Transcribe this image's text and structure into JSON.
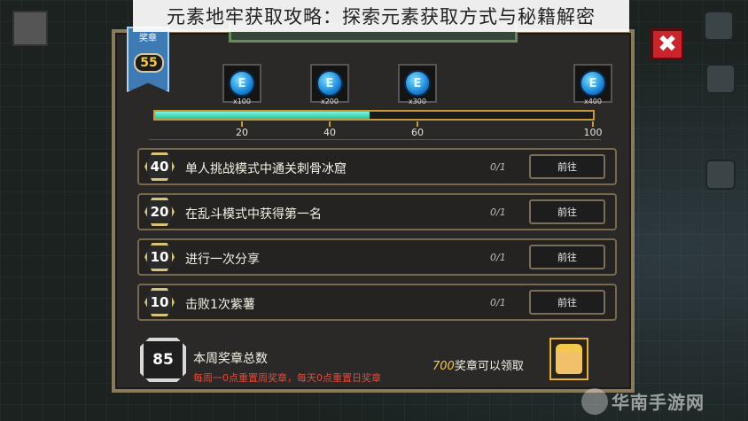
{
  "overlay_title": "元素地牢获取攻略：探索元素获取方式与秘籍解密",
  "badge": {
    "label": "奖章",
    "level": "55"
  },
  "rewards": [
    {
      "symbol": "E",
      "qty": "x100"
    },
    {
      "symbol": "E",
      "qty": "x200"
    },
    {
      "symbol": "E",
      "qty": "x300"
    },
    {
      "symbol": "E",
      "qty": "x400"
    }
  ],
  "progress": {
    "current": 49,
    "max": 100,
    "ticks": [
      "20",
      "40",
      "60",
      "100"
    ]
  },
  "tasks": [
    {
      "points": "40",
      "label": "单人挑战模式中通关刺骨冰窟",
      "progress": "0/1",
      "button": "前往"
    },
    {
      "points": "20",
      "label": "在乱斗模式中获得第一名",
      "progress": "0/1",
      "button": "前往"
    },
    {
      "points": "10",
      "label": "进行一次分享",
      "progress": "0/1",
      "button": "前往"
    },
    {
      "points": "10",
      "label": "击败1次紫薯",
      "progress": "0/1",
      "button": "前往"
    }
  ],
  "weekly": {
    "total": "85",
    "title": "本周奖章总数",
    "note": "每周一0点重置周奖章，每天0点重置日奖章",
    "claim_num": "700",
    "claim_text": "奖章可以领取"
  },
  "close_icon": "✖",
  "watermark": "华南手游网"
}
